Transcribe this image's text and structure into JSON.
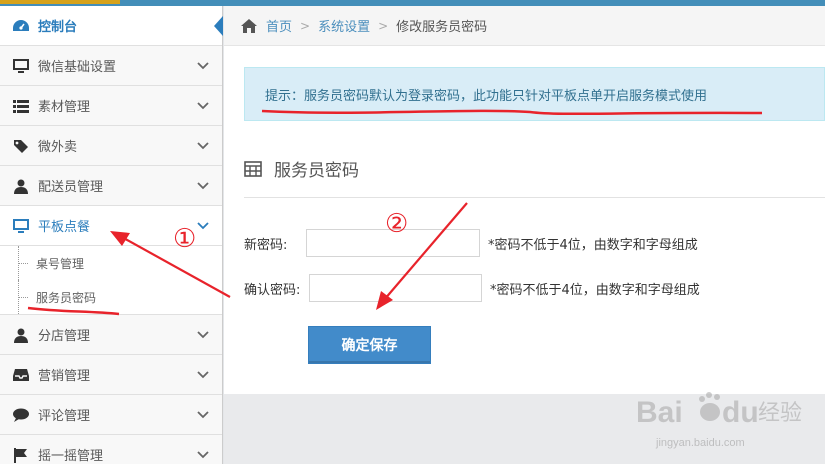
{
  "sidebar": {
    "items": [
      {
        "label": "控制台",
        "icon": "dashboard-icon"
      },
      {
        "label": "微信基础设置",
        "icon": "desktop-icon"
      },
      {
        "label": "素材管理",
        "icon": "list-icon"
      },
      {
        "label": "微外卖",
        "icon": "tag-icon"
      },
      {
        "label": "配送员管理",
        "icon": "user-icon"
      },
      {
        "label": "平板点餐",
        "icon": "desktop-icon"
      },
      {
        "label": "分店管理",
        "icon": "user-icon"
      },
      {
        "label": "营销管理",
        "icon": "inbox-icon"
      },
      {
        "label": "评论管理",
        "icon": "comment-icon"
      },
      {
        "label": "摇一摇管理",
        "icon": "flag-icon"
      }
    ],
    "subitems": [
      {
        "label": "桌号管理"
      },
      {
        "label": "服务员密码"
      }
    ]
  },
  "breadcrumb": {
    "home": "首页",
    "level1": "系统设置",
    "current": "修改服务员密码"
  },
  "alert": {
    "text": "提示：服务员密码默认为登录密码，此功能只针对平板点单开启服务模式使用"
  },
  "section": {
    "title": "服务员密码"
  },
  "form": {
    "new_password_label": "新密码:",
    "new_password_hint": "*密码不低于4位，由数字和字母组成",
    "confirm_password_label": "确认密码:",
    "confirm_password_hint": "*密码不低于4位，由数字和字母组成",
    "save_label": "确定保存"
  },
  "annotations": {
    "marker1": "①",
    "marker2": "②"
  },
  "watermark": {
    "brand": "Bai",
    "brand2": "du",
    "suffix": "经验",
    "url": "jingyan.baidu.com"
  },
  "colors": {
    "accent": "#2b7dbc",
    "primary_button": "#428bca",
    "alert_bg": "#d9edf7",
    "alert_text": "#31708f",
    "annotation_red": "#e8232b"
  }
}
